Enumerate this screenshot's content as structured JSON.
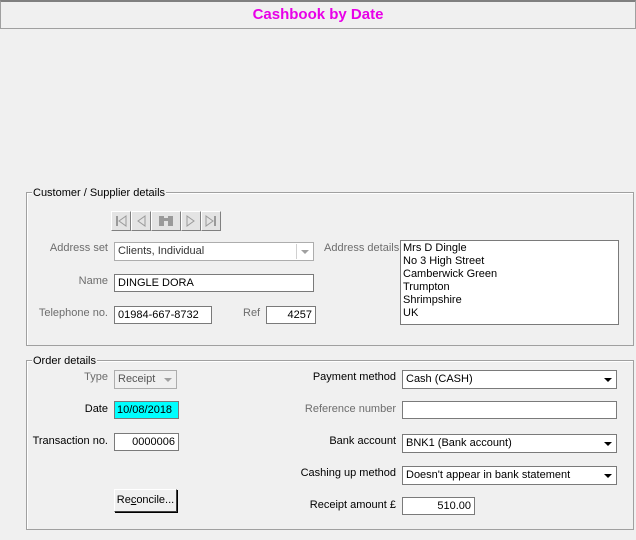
{
  "window": {
    "title": "Cashbook by Date"
  },
  "customer": {
    "legend": "Customer / Supplier details",
    "nav_icons": [
      "first-record-icon",
      "previous-record-icon",
      "find-binoculars-icon",
      "next-record-icon",
      "last-record-icon"
    ],
    "address_set_label": "Address set",
    "address_set_value": "Clients, Individual",
    "address_details_label": "Address details",
    "address_lines": [
      "Mrs D Dingle",
      "No 3 High Street",
      "Camberwick Green",
      "Trumpton",
      "Shrimpshire",
      "UK"
    ],
    "name_label": "Name",
    "name_value": "DINGLE DORA",
    "telephone_label": "Telephone no.",
    "telephone_value": "01984-667-8732",
    "ref_label": "Ref",
    "ref_value": "4257"
  },
  "order": {
    "legend": "Order details",
    "type_label": "Type",
    "type_value": "Receipt",
    "date_label": "Date",
    "date_value": "10/08/2018",
    "transaction_label": "Transaction no.",
    "transaction_value": "0000006",
    "reconcile_button": "Reconcile...",
    "payment_method_label": "Payment method",
    "payment_method_value": "Cash (CASH)",
    "reference_label": "Reference number",
    "reference_value": "",
    "bank_account_label": "Bank account",
    "bank_account_value": "BNK1 (Bank account)",
    "cashing_up_label": "Cashing up method",
    "cashing_up_value": "Doesn't appear in bank statement",
    "receipt_amount_label": "Receipt amount £",
    "receipt_amount_value": "510.00"
  },
  "colors": {
    "title": "#e800e8",
    "date_highlight": "#00ffff"
  }
}
